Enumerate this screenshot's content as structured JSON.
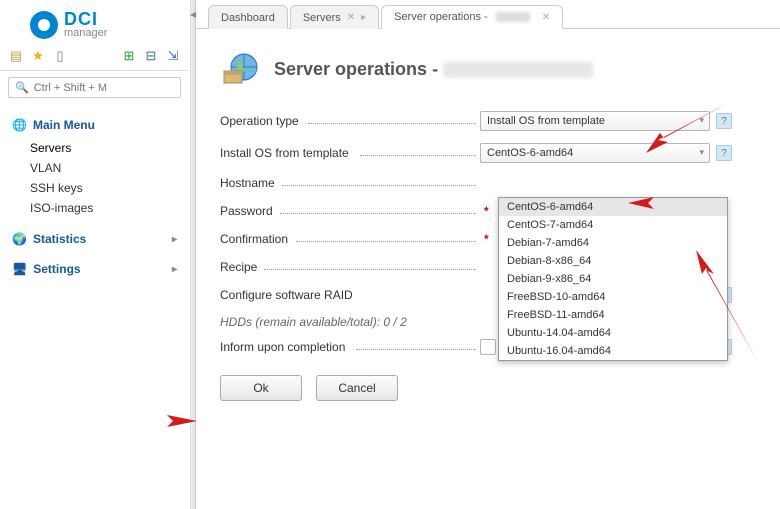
{
  "logo": {
    "dci": "DCI",
    "manager": "manager"
  },
  "search": {
    "placeholder": "Ctrl + Shift + M"
  },
  "nav": {
    "main": {
      "label": "Main Menu",
      "items": [
        "Servers",
        "VLAN",
        "SSH keys",
        "ISO-images"
      ]
    },
    "stats": {
      "label": "Statistics"
    },
    "settings": {
      "label": "Settings"
    }
  },
  "tabs": {
    "dashboard": "Dashboard",
    "servers": "Servers",
    "ops_prefix": "Server operations - "
  },
  "panel": {
    "title_prefix": "Server operations - ",
    "fields": {
      "operation_type": "Operation type",
      "install_template": "Install OS from template",
      "hostname": "Hostname",
      "password": "Password",
      "confirmation": "Confirmation",
      "recipe": "Recipe",
      "raid": "Configure software RAID",
      "hdd_note": "HDDs (remain available/total): 0 / 2",
      "inform": "Inform upon completion"
    },
    "values": {
      "operation_type": "Install OS from template",
      "install_template": "CentOS-6-amd64"
    },
    "os_options": [
      "CentOS-6-amd64",
      "CentOS-7-amd64",
      "Debian-7-amd64",
      "Debian-8-x86_64",
      "Debian-9-x86_64",
      "FreeBSD-10-amd64",
      "FreeBSD-11-amd64",
      "Ubuntu-14.04-amd64",
      "Ubuntu-16.04-amd64"
    ],
    "buttons": {
      "ok": "Ok",
      "cancel": "Cancel"
    }
  },
  "icons": {
    "help": "?",
    "star": "★",
    "clip": "📋",
    "plus": "➕",
    "minus": "📉",
    "pin": "📌",
    "search": "🔍",
    "lists": "≡"
  }
}
